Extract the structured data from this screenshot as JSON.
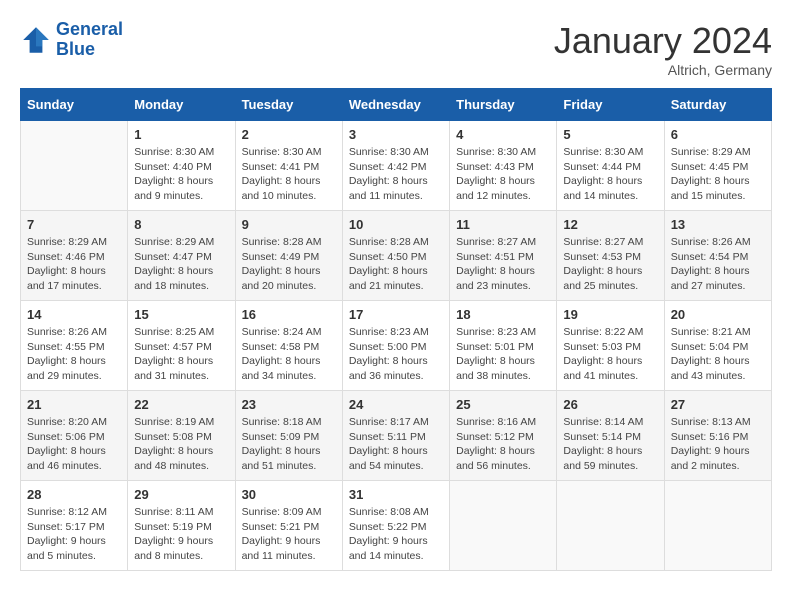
{
  "header": {
    "logo_line1": "General",
    "logo_line2": "Blue",
    "month": "January 2024",
    "location": "Altrich, Germany"
  },
  "days_of_week": [
    "Sunday",
    "Monday",
    "Tuesday",
    "Wednesday",
    "Thursday",
    "Friday",
    "Saturday"
  ],
  "weeks": [
    [
      {
        "day": "",
        "empty": true
      },
      {
        "day": "1",
        "sunrise": "Sunrise: 8:30 AM",
        "sunset": "Sunset: 4:40 PM",
        "daylight": "Daylight: 8 hours and 9 minutes."
      },
      {
        "day": "2",
        "sunrise": "Sunrise: 8:30 AM",
        "sunset": "Sunset: 4:41 PM",
        "daylight": "Daylight: 8 hours and 10 minutes."
      },
      {
        "day": "3",
        "sunrise": "Sunrise: 8:30 AM",
        "sunset": "Sunset: 4:42 PM",
        "daylight": "Daylight: 8 hours and 11 minutes."
      },
      {
        "day": "4",
        "sunrise": "Sunrise: 8:30 AM",
        "sunset": "Sunset: 4:43 PM",
        "daylight": "Daylight: 8 hours and 12 minutes."
      },
      {
        "day": "5",
        "sunrise": "Sunrise: 8:30 AM",
        "sunset": "Sunset: 4:44 PM",
        "daylight": "Daylight: 8 hours and 14 minutes."
      },
      {
        "day": "6",
        "sunrise": "Sunrise: 8:29 AM",
        "sunset": "Sunset: 4:45 PM",
        "daylight": "Daylight: 8 hours and 15 minutes."
      }
    ],
    [
      {
        "day": "7",
        "sunrise": "Sunrise: 8:29 AM",
        "sunset": "Sunset: 4:46 PM",
        "daylight": "Daylight: 8 hours and 17 minutes."
      },
      {
        "day": "8",
        "sunrise": "Sunrise: 8:29 AM",
        "sunset": "Sunset: 4:47 PM",
        "daylight": "Daylight: 8 hours and 18 minutes."
      },
      {
        "day": "9",
        "sunrise": "Sunrise: 8:28 AM",
        "sunset": "Sunset: 4:49 PM",
        "daylight": "Daylight: 8 hours and 20 minutes."
      },
      {
        "day": "10",
        "sunrise": "Sunrise: 8:28 AM",
        "sunset": "Sunset: 4:50 PM",
        "daylight": "Daylight: 8 hours and 21 minutes."
      },
      {
        "day": "11",
        "sunrise": "Sunrise: 8:27 AM",
        "sunset": "Sunset: 4:51 PM",
        "daylight": "Daylight: 8 hours and 23 minutes."
      },
      {
        "day": "12",
        "sunrise": "Sunrise: 8:27 AM",
        "sunset": "Sunset: 4:53 PM",
        "daylight": "Daylight: 8 hours and 25 minutes."
      },
      {
        "day": "13",
        "sunrise": "Sunrise: 8:26 AM",
        "sunset": "Sunset: 4:54 PM",
        "daylight": "Daylight: 8 hours and 27 minutes."
      }
    ],
    [
      {
        "day": "14",
        "sunrise": "Sunrise: 8:26 AM",
        "sunset": "Sunset: 4:55 PM",
        "daylight": "Daylight: 8 hours and 29 minutes."
      },
      {
        "day": "15",
        "sunrise": "Sunrise: 8:25 AM",
        "sunset": "Sunset: 4:57 PM",
        "daylight": "Daylight: 8 hours and 31 minutes."
      },
      {
        "day": "16",
        "sunrise": "Sunrise: 8:24 AM",
        "sunset": "Sunset: 4:58 PM",
        "daylight": "Daylight: 8 hours and 34 minutes."
      },
      {
        "day": "17",
        "sunrise": "Sunrise: 8:23 AM",
        "sunset": "Sunset: 5:00 PM",
        "daylight": "Daylight: 8 hours and 36 minutes."
      },
      {
        "day": "18",
        "sunrise": "Sunrise: 8:23 AM",
        "sunset": "Sunset: 5:01 PM",
        "daylight": "Daylight: 8 hours and 38 minutes."
      },
      {
        "day": "19",
        "sunrise": "Sunrise: 8:22 AM",
        "sunset": "Sunset: 5:03 PM",
        "daylight": "Daylight: 8 hours and 41 minutes."
      },
      {
        "day": "20",
        "sunrise": "Sunrise: 8:21 AM",
        "sunset": "Sunset: 5:04 PM",
        "daylight": "Daylight: 8 hours and 43 minutes."
      }
    ],
    [
      {
        "day": "21",
        "sunrise": "Sunrise: 8:20 AM",
        "sunset": "Sunset: 5:06 PM",
        "daylight": "Daylight: 8 hours and 46 minutes."
      },
      {
        "day": "22",
        "sunrise": "Sunrise: 8:19 AM",
        "sunset": "Sunset: 5:08 PM",
        "daylight": "Daylight: 8 hours and 48 minutes."
      },
      {
        "day": "23",
        "sunrise": "Sunrise: 8:18 AM",
        "sunset": "Sunset: 5:09 PM",
        "daylight": "Daylight: 8 hours and 51 minutes."
      },
      {
        "day": "24",
        "sunrise": "Sunrise: 8:17 AM",
        "sunset": "Sunset: 5:11 PM",
        "daylight": "Daylight: 8 hours and 54 minutes."
      },
      {
        "day": "25",
        "sunrise": "Sunrise: 8:16 AM",
        "sunset": "Sunset: 5:12 PM",
        "daylight": "Daylight: 8 hours and 56 minutes."
      },
      {
        "day": "26",
        "sunrise": "Sunrise: 8:14 AM",
        "sunset": "Sunset: 5:14 PM",
        "daylight": "Daylight: 8 hours and 59 minutes."
      },
      {
        "day": "27",
        "sunrise": "Sunrise: 8:13 AM",
        "sunset": "Sunset: 5:16 PM",
        "daylight": "Daylight: 9 hours and 2 minutes."
      }
    ],
    [
      {
        "day": "28",
        "sunrise": "Sunrise: 8:12 AM",
        "sunset": "Sunset: 5:17 PM",
        "daylight": "Daylight: 9 hours and 5 minutes."
      },
      {
        "day": "29",
        "sunrise": "Sunrise: 8:11 AM",
        "sunset": "Sunset: 5:19 PM",
        "daylight": "Daylight: 9 hours and 8 minutes."
      },
      {
        "day": "30",
        "sunrise": "Sunrise: 8:09 AM",
        "sunset": "Sunset: 5:21 PM",
        "daylight": "Daylight: 9 hours and 11 minutes."
      },
      {
        "day": "31",
        "sunrise": "Sunrise: 8:08 AM",
        "sunset": "Sunset: 5:22 PM",
        "daylight": "Daylight: 9 hours and 14 minutes."
      },
      {
        "day": "",
        "empty": true
      },
      {
        "day": "",
        "empty": true
      },
      {
        "day": "",
        "empty": true
      }
    ]
  ]
}
